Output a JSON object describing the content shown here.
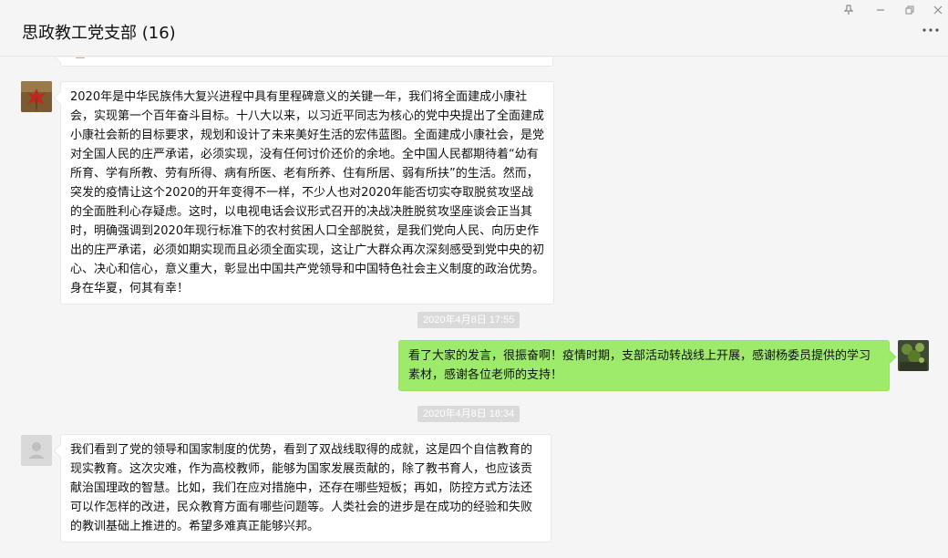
{
  "window": {
    "title": "思政教工党支部 (16)"
  },
  "controls": {
    "pin_icon": "pin-icon",
    "minimize_icon": "minimize-icon",
    "restore_icon": "restore-icon",
    "close_icon": "close-icon",
    "more_icon": "more-icon"
  },
  "messages": {
    "m1_text": "2020年是中华民族伟大复兴进程中具有里程碑意义的关键一年，我们将全面建成小康社会，实现第一个百年奋斗目标。十八大以来，以习近平同志为核心的党中央提出了全面建成小康社会新的目标要求，规划和设计了未来美好生活的宏伟蓝图。全面建成小康社会，是党对全国人民的庄严承诺，必须实现，没有任何讨价还价的余地。全中国人民都期待着“幼有所育、学有所教、劳有所得、病有所医、老有所养、住有所居、弱有所扶”的生活。然而，突发的疫情让这个2020的开年变得不一样，不少人也对2020年能否切实夺取脱贫攻坚战的全面胜利心存疑虑。这时，以电视电话会议形式召开的决战决胜脱贫攻坚座谈会正当其时，明确强调到2020年现行标准下的农村贫困人口全部脱贫，是我们党向人民、向历史作出的庄严承诺，必须如期实现而且必须全面实现，这让广大群众再次深刻感受到党中央的初心、决心和信心，意义重大，彰显出中国共产党领导和中国特色社会主义制度的政治优势。身在华夏，何其有幸！",
    "ts1": "2020年4月8日 17:55",
    "m2_text": "看了大家的发言，很振奋啊！疫情时期，支部活动转战线上开展，感谢杨委员提供的学习素材，感谢各位老师的支持！",
    "ts2": "2020年4月8日 18:34",
    "m3_text": "我们看到了党的领导和国家制度的优势，看到了双战线取得的成就，这是四个自信教育的现实教育。这次灾难，作为高校教师，能够为国家发展贡献的，除了教书育人，也应该贡献治国理政的智慧。比如，我们在应对措施中，还存在哪些短板；再如，防控方式方法还可以作怎样的改进，民众教育方面有哪些问题等。人类社会的进步是在成功的经验和失败的教训基础上推进的。希望多难真正能够兴邦。"
  },
  "colors": {
    "self_bubble": "#9eea6a",
    "other_bubble": "#ffffff",
    "background": "#f5f5f5",
    "timestamp_bg": "#dadada"
  }
}
